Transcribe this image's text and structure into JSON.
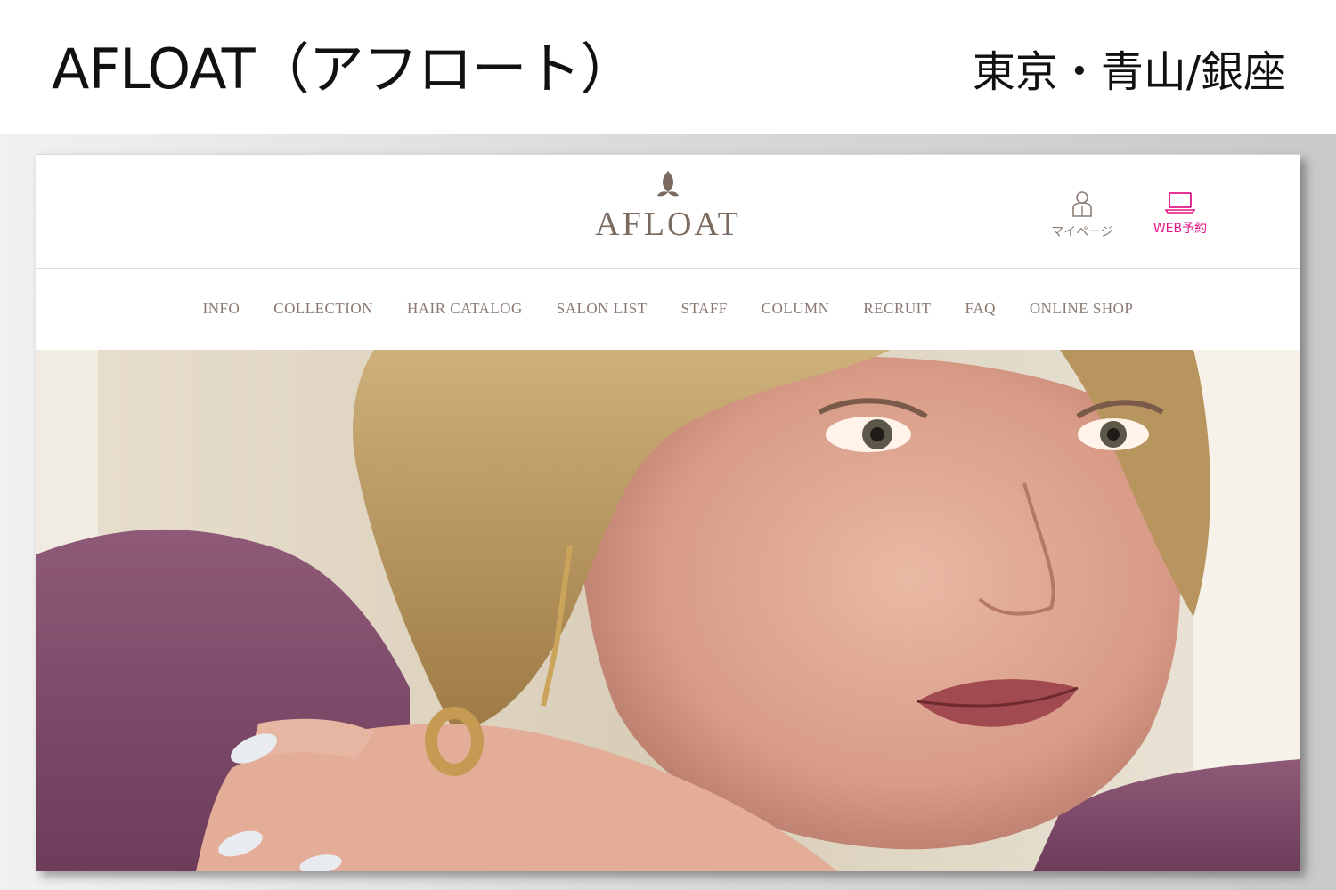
{
  "caption": {
    "title": "AFLOAT（アフロート）",
    "location": "東京・青山/銀座"
  },
  "site": {
    "logo_text": "AFLOAT",
    "header_actions": {
      "mypage": {
        "label": "マイページ",
        "icon": "user-icon"
      },
      "web_reservation": {
        "label": "WEB予約",
        "icon": "laptop-icon"
      }
    },
    "nav": [
      {
        "label": "INFO"
      },
      {
        "label": "COLLECTION"
      },
      {
        "label": "HAIR CATALOG"
      },
      {
        "label": "SALON LIST"
      },
      {
        "label": "STAFF"
      },
      {
        "label": "COLUMN"
      },
      {
        "label": "RECRUIT"
      },
      {
        "label": "FAQ"
      },
      {
        "label": "ONLINE SHOP"
      }
    ]
  },
  "colors": {
    "brand_brown": "#7b6a60",
    "nav_text": "#8a7870",
    "accent_pink": "#e5168a",
    "sweater_purple": "#7e4a6a"
  }
}
